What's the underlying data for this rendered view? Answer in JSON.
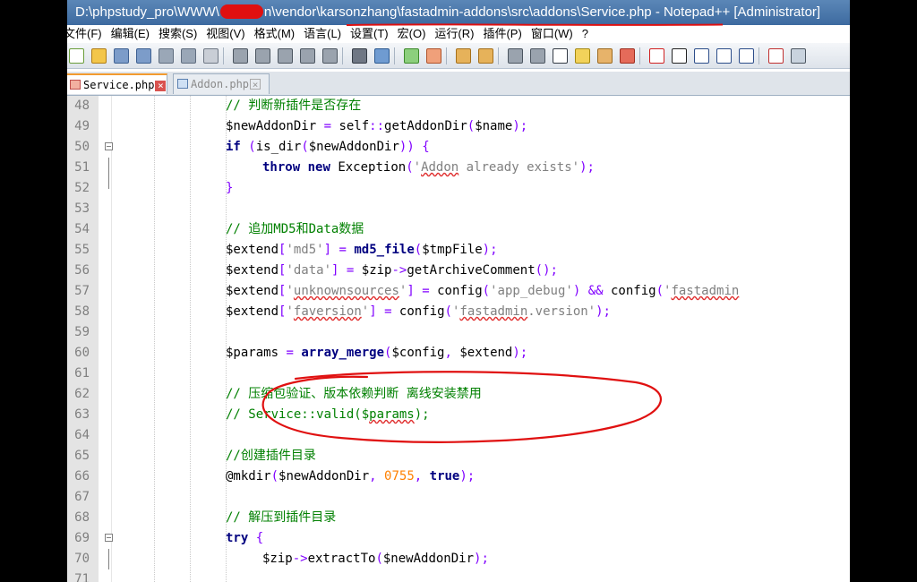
{
  "window": {
    "title_prefix": "D:\\phpstudy_pro\\WWW\\",
    "title_suffix": "n\\vendor\\karsonzhang\\fastadmin-addons\\src\\addons\\Service.php - Notepad++ [Administrator]"
  },
  "menu": [
    "文件(F)",
    "编辑(E)",
    "搜索(S)",
    "视图(V)",
    "格式(M)",
    "语言(L)",
    "设置(T)",
    "宏(O)",
    "运行(R)",
    "插件(P)",
    "窗口(W)",
    "?"
  ],
  "tabs": [
    {
      "label": "Service.php",
      "active": true
    },
    {
      "label": "Addon.php",
      "active": false
    }
  ],
  "lines": [
    {
      "n": "48",
      "parts": [
        [
          "cm",
          "// 判断新插件是否存在"
        ]
      ]
    },
    {
      "n": "49",
      "parts": [
        [
          "",
          "$newAddonDir "
        ],
        [
          "op",
          "="
        ],
        [
          "",
          " self"
        ],
        [
          "op",
          "::"
        ],
        [
          "",
          "getAddonDir"
        ],
        [
          "op",
          "("
        ],
        [
          "",
          "$name"
        ],
        [
          "op",
          ");"
        ]
      ]
    },
    {
      "n": "50",
      "fold": "start",
      "parts": [
        [
          "kw",
          "if"
        ],
        [
          "",
          " "
        ],
        [
          "op",
          "("
        ],
        [
          "",
          "is_dir"
        ],
        [
          "op",
          "("
        ],
        [
          "",
          "$newAddonDir"
        ],
        [
          "op",
          "))"
        ],
        [
          "",
          " "
        ],
        [
          "op",
          "{"
        ]
      ]
    },
    {
      "n": "51",
      "ind": 2,
      "parts": [
        [
          "kw",
          "throw"
        ],
        [
          "",
          " "
        ],
        [
          "kw",
          "new"
        ],
        [
          "",
          " Exception"
        ],
        [
          "op",
          "("
        ],
        [
          "st",
          "'"
        ],
        [
          "st hl",
          "Addon"
        ],
        [
          "st",
          " already exists'"
        ],
        [
          "op",
          ");"
        ]
      ]
    },
    {
      "n": "52",
      "fold": "end",
      "parts": [
        [
          "op",
          "}"
        ]
      ]
    },
    {
      "n": "53",
      "parts": []
    },
    {
      "n": "54",
      "parts": [
        [
          "cm",
          "// 追加MD5和Data数据"
        ]
      ]
    },
    {
      "n": "55",
      "parts": [
        [
          "",
          "$extend"
        ],
        [
          "op",
          "["
        ],
        [
          "st",
          "'md5'"
        ],
        [
          "op",
          "]"
        ],
        [
          "",
          " "
        ],
        [
          "op",
          "="
        ],
        [
          "",
          " "
        ],
        [
          "fn",
          "md5_file"
        ],
        [
          "op",
          "("
        ],
        [
          "",
          "$tmpFile"
        ],
        [
          "op",
          ");"
        ]
      ]
    },
    {
      "n": "56",
      "parts": [
        [
          "",
          "$extend"
        ],
        [
          "op",
          "["
        ],
        [
          "st",
          "'data'"
        ],
        [
          "op",
          "]"
        ],
        [
          "",
          " "
        ],
        [
          "op",
          "="
        ],
        [
          "",
          " $zip"
        ],
        [
          "op",
          "->"
        ],
        [
          "",
          "getArchiveComment"
        ],
        [
          "op",
          "();"
        ]
      ]
    },
    {
      "n": "57",
      "parts": [
        [
          "",
          "$extend"
        ],
        [
          "op",
          "["
        ],
        [
          "st",
          "'"
        ],
        [
          "st hl",
          "unknownsources"
        ],
        [
          "st",
          "'"
        ],
        [
          "op",
          "]"
        ],
        [
          "",
          " "
        ],
        [
          "op",
          "="
        ],
        [
          "",
          " config"
        ],
        [
          "op",
          "("
        ],
        [
          "st",
          "'app_debug'"
        ],
        [
          "op",
          ")"
        ],
        [
          "",
          " "
        ],
        [
          "op",
          "&&"
        ],
        [
          "",
          " config"
        ],
        [
          "op",
          "("
        ],
        [
          "st",
          "'"
        ],
        [
          "st hl",
          "fastadmin"
        ]
      ]
    },
    {
      "n": "58",
      "parts": [
        [
          "",
          "$extend"
        ],
        [
          "op",
          "["
        ],
        [
          "st",
          "'"
        ],
        [
          "st hl",
          "faversion"
        ],
        [
          "st",
          "'"
        ],
        [
          "op",
          "]"
        ],
        [
          "",
          " "
        ],
        [
          "op",
          "="
        ],
        [
          "",
          " config"
        ],
        [
          "op",
          "("
        ],
        [
          "st",
          "'"
        ],
        [
          "st hl",
          "fastadmin"
        ],
        [
          "st",
          ".version'"
        ],
        [
          "op",
          ");"
        ]
      ]
    },
    {
      "n": "59",
      "parts": []
    },
    {
      "n": "60",
      "parts": [
        [
          "",
          "$params "
        ],
        [
          "op",
          "="
        ],
        [
          "",
          " "
        ],
        [
          "fn",
          "array_merge"
        ],
        [
          "op",
          "("
        ],
        [
          "",
          "$config"
        ],
        [
          "op",
          ","
        ],
        [
          "",
          " $extend"
        ],
        [
          "op",
          ");"
        ]
      ]
    },
    {
      "n": "61",
      "parts": []
    },
    {
      "n": "62",
      "parts": [
        [
          "cm",
          "// 压缩包验证、版本依赖判断 离线安装禁用"
        ]
      ]
    },
    {
      "n": "63",
      "parts": [
        [
          "cm",
          "// Service::valid($"
        ],
        [
          "cm hl",
          "params"
        ],
        [
          "cm",
          ");"
        ]
      ]
    },
    {
      "n": "64",
      "parts": []
    },
    {
      "n": "65",
      "parts": [
        [
          "cm",
          "//创建插件目录"
        ]
      ]
    },
    {
      "n": "66",
      "parts": [
        [
          "",
          "@mkdir"
        ],
        [
          "op",
          "("
        ],
        [
          "",
          "$newAddonDir"
        ],
        [
          "op",
          ","
        ],
        [
          "",
          " "
        ],
        [
          "num",
          "0755"
        ],
        [
          "op",
          ","
        ],
        [
          "",
          " "
        ],
        [
          "kw",
          "true"
        ],
        [
          "op",
          ");"
        ]
      ]
    },
    {
      "n": "67",
      "parts": []
    },
    {
      "n": "68",
      "parts": [
        [
          "cm",
          "// 解压到插件目录"
        ]
      ]
    },
    {
      "n": "69",
      "fold": "start",
      "parts": [
        [
          "kw",
          "try"
        ],
        [
          "",
          " "
        ],
        [
          "op",
          "{"
        ]
      ]
    },
    {
      "n": "70",
      "ind": 2,
      "parts": [
        [
          "",
          "$zip"
        ],
        [
          "op",
          "->"
        ],
        [
          "",
          "extractTo"
        ],
        [
          "op",
          "("
        ],
        [
          "",
          "$newAddonDir"
        ],
        [
          "op",
          ");"
        ]
      ]
    },
    {
      "n": "71",
      "parts": []
    }
  ]
}
